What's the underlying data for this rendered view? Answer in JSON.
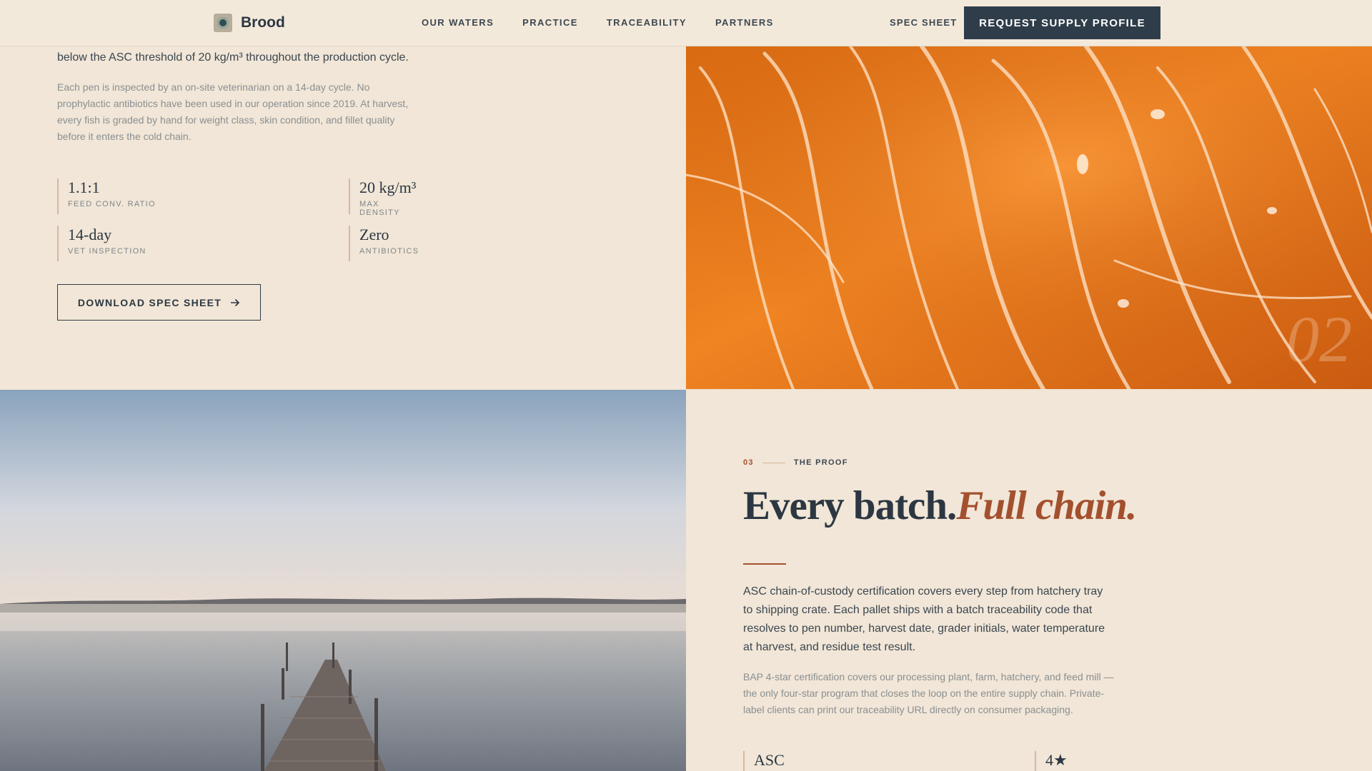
{
  "nav": {
    "brand": "Brood",
    "links": [
      "OUR WATERS",
      "PRACTICE",
      "TRACEABILITY",
      "PARTNERS"
    ],
    "spec_sheet": "SPEC SHEET",
    "cta": "REQUEST SUPPLY PROFILE"
  },
  "practice": {
    "lead": "below the ASC threshold of 20 kg/m³ throughout the production cycle.",
    "body": "Each pen is inspected by an on-site veterinarian on a 14-day cycle. No prophylactic antibiotics have been used in our operation since 2019. At harvest, every fish is graded by hand for weight class, skin condition, and fillet quality before it enters the cold chain.",
    "stats": [
      {
        "value": "1.1:1",
        "label": "FEED CONV. RATIO"
      },
      {
        "value": "20 kg/m³",
        "label": "MAX DENSITY"
      },
      {
        "value": "14-day",
        "label": "VET INSPECTION"
      },
      {
        "value": "Zero",
        "label": "ANTIBIOTICS"
      }
    ],
    "download_label": "DOWNLOAD SPEC SHEET",
    "image_number": "02"
  },
  "proof": {
    "eyebrow_num": "03",
    "eyebrow_label": "THE PROOF",
    "headline_plain": "Every batch.",
    "headline_accent": "Full chain.",
    "lead": "ASC chain-of-custody certification covers every step from hatchery tray to shipping crate. Each pallet ships with a batch traceability code that resolves to pen number, harvest date, grader initials, water temperature at harvest, and residue test result.",
    "body": "BAP 4-star certification covers our processing plant, farm, hatchery, and feed mill — the only four-star program that closes the loop on the entire supply chain. Private-label clients can print our traceability URL directly on consumer packaging.",
    "stats": [
      {
        "value": "ASC"
      },
      {
        "value": "4★"
      }
    ]
  },
  "colors": {
    "background": "#f1e6d7",
    "navy": "#2f3d4a",
    "accent": "#a3502e"
  }
}
